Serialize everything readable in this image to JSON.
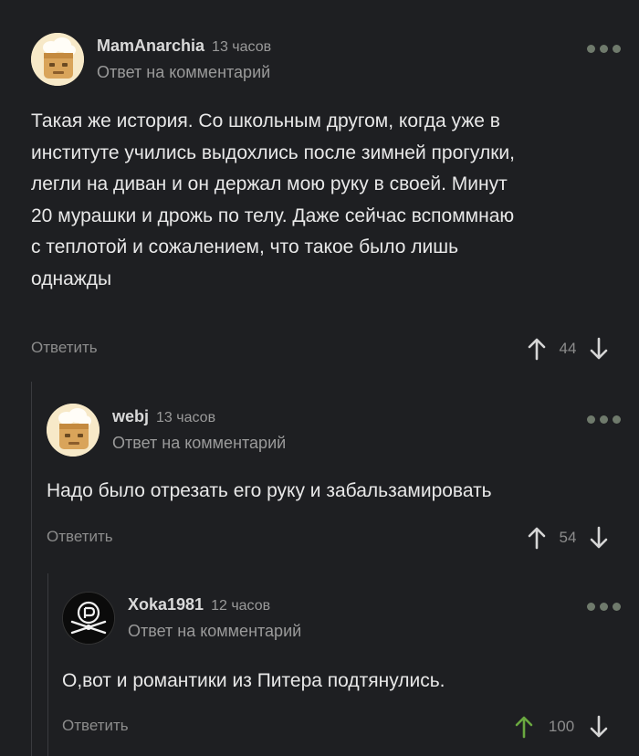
{
  "comments": [
    {
      "author": "MamAnarchia",
      "time": "13 часов",
      "reply_note": "Ответ на комментарий",
      "text_lines": [
        "Такая же история. Со школьным другом, когда уже в",
        "институте учились  выдохлись после зимней прогулки,",
        "легли на диван и он держал мою руку в своей. Минут",
        "20 мурашки и дрожь по телу. Даже сейчас вспоммнаю",
        "с теплотой и сожалением, что такое было лишь",
        "однажды"
      ],
      "reply_label": "Ответить",
      "rating": "44",
      "upvoted": false,
      "avatar_icon": "chef-hat-avatar-icon"
    },
    {
      "author": "webj",
      "time": "13 часов",
      "reply_note": "Ответ на комментарий",
      "text_lines": [
        "Надо было отрезать его руку и забальзамировать"
      ],
      "reply_label": "Ответить",
      "rating": "54",
      "upvoted": false,
      "avatar_icon": "chef-hat-avatar-icon"
    },
    {
      "author": "Xoka1981",
      "time": "12 часов",
      "reply_note": "Ответ на комментарий",
      "text_lines": [
        "О,вот и романтики из Питера подтянулись."
      ],
      "reply_label": "Ответить",
      "rating": "100",
      "upvoted": true,
      "avatar_icon": "pirate-skull-avatar-icon"
    }
  ],
  "colors": {
    "background": "#1e1f22",
    "text": "#e8e8e8",
    "muted": "#9a9a9a",
    "upvote_active": "#6aa840",
    "more_dots": "#6f7a6c"
  }
}
